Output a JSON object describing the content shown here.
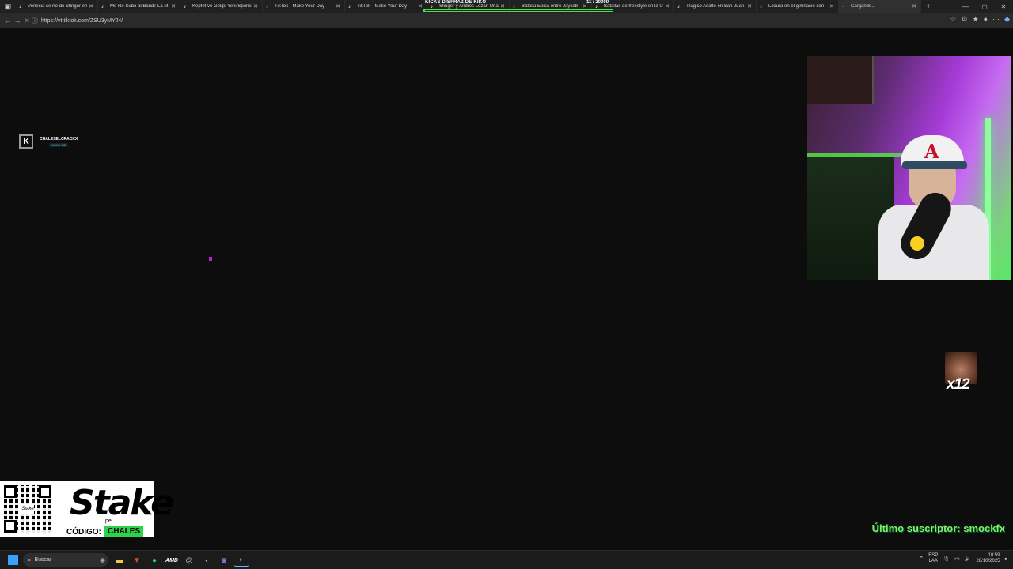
{
  "browser": {
    "tabs": [
      {
        "title": "Venecia se ríe de Stinger en",
        "favicon": "tiktok-icon"
      },
      {
        "title": "Me Re Subo al Bondi: La M",
        "favicon": "tiktok-icon"
      },
      {
        "title": "Kepfet ve Gelip: Yeni Sponsor",
        "favicon": "tiktok-icon"
      },
      {
        "title": "TikTok - Make Your Day",
        "favicon": "tiktok-icon"
      },
      {
        "title": "TikTok - Make Your Day",
        "favicon": "tiktok-icon"
      },
      {
        "title": "Stinger y Andres Lozan Una",
        "favicon": "tiktok-icon"
      },
      {
        "title": "Batalla Épica entre Jaycob",
        "favicon": "tiktok-icon"
      },
      {
        "title": "Batallas de freestyle en la U",
        "favicon": "tiktok-icon"
      },
      {
        "title": "Trágico Asalto en San Juan",
        "favicon": "tiktok-icon"
      },
      {
        "title": "Locura en el gimnasio con",
        "favicon": "tiktok-icon"
      },
      {
        "title": "Cargando...",
        "favicon": "loading-icon"
      }
    ],
    "url": "https://vt.tiktok.com/ZSU3yMYJ4/"
  },
  "overlays": {
    "kicks_title": "KICKS DISFRAZ DE KIKO",
    "kicks_count": "11 / 20000",
    "kicks_progress": 0.00055,
    "chales_name": "CHALESELCRACKX",
    "chales_tag": "SIGUE ME",
    "emote_count": "x12",
    "last_subscriber": "Último suscriptor: smockfx"
  },
  "stake_ad": {
    "brand": "Stake",
    "domain": ".pe",
    "code_label": "CÓDIGO:",
    "code": "CHALES",
    "accent_color": "#2fd248"
  },
  "taskbar": {
    "search_placeholder": "Buscar",
    "lang_line1": "ESP",
    "lang_line2": "LAA",
    "time": "18:59",
    "date": "28/10/2025"
  }
}
